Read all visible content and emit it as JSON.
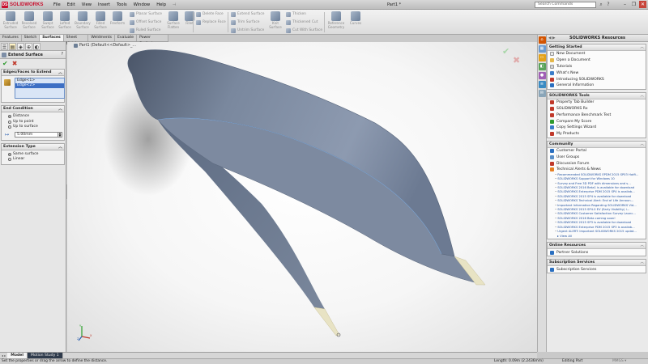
{
  "app": {
    "logo_text": "SOLIDWORKS",
    "doc_title": "Part1 *",
    "menu": [
      "File",
      "Edit",
      "View",
      "Insert",
      "Tools",
      "Window",
      "Help"
    ],
    "menu_pin": "⊣",
    "search_placeholder": "Search Commands",
    "window_controls": [
      "–",
      "❐",
      "✕"
    ]
  },
  "ribbon": {
    "big": [
      {
        "label": "Extruded Surface"
      },
      {
        "label": "Revolved Surface"
      },
      {
        "label": "Swept Surface"
      },
      {
        "label": "Lofted Surface"
      },
      {
        "label": "Boundary Surface"
      },
      {
        "label": "Filled Surface"
      },
      {
        "label": "Freeform"
      },
      {
        "label": "Surface Flatten"
      },
      {
        "label": "Fillet"
      },
      {
        "label": "Knit Surface"
      },
      {
        "label": "Reference Geometry"
      },
      {
        "label": "Curves"
      }
    ],
    "small": [
      "Planar Surface",
      "Offset Surface",
      "Ruled Surface",
      "Delete Face",
      "Replace Face",
      "Extend Surface",
      "Trim Surface",
      "Untrim Surface",
      "Thicken",
      "Thickened Cut",
      "Cut With Surface"
    ]
  },
  "tabs": [
    "Features",
    "Sketch",
    "Surfaces",
    "Sheet Metal",
    "Weldments",
    "Evaluate",
    "Power Surfacing"
  ],
  "active_tab": "Surfaces",
  "property_manager": {
    "title": "Extend Surface",
    "help": "?",
    "ok": "✔",
    "cancel": "✖",
    "edges_group": {
      "title": "Edges/Faces to Extend",
      "items": [
        "Edge<1>",
        "Edge<2>"
      ]
    },
    "end_condition": {
      "title": "End Condition",
      "options": [
        "Distance",
        "Up to point",
        "Up to surface"
      ],
      "selected": "Distance",
      "distance_value": "5.00mm"
    },
    "extension_type": {
      "title": "Extension Type",
      "options": [
        "Same surface",
        "Linear"
      ],
      "selected": "Same surface"
    },
    "collapse_glyph": "︿"
  },
  "viewport": {
    "tree_label": "Part1  (Default<<Default>_...",
    "confirm_ok": "✔",
    "confirm_cancel": "✖",
    "triad": {
      "x": "X",
      "y": "Y",
      "z": "Z"
    },
    "body_color": "#6f7d94",
    "extension_color": "#e8e3c4"
  },
  "task_pane": {
    "title": "SOLIDWORKS Resources",
    "nav": "◀ ▶",
    "getting_started": {
      "title": "Getting Started",
      "items": [
        "New Document",
        "Open a Document",
        "Tutorials",
        "What's New",
        "Introducing SOLIDWORKS",
        "General Information"
      ]
    },
    "tools": {
      "title": "SOLIDWORKS Tools",
      "items": [
        "Property Tab Builder",
        "SOLIDWORKS Rx",
        "Performance Benchmark Test",
        "Compare My Score",
        "Copy Settings Wizard",
        "My Products"
      ]
    },
    "community": {
      "title": "Community",
      "items": [
        "Customer Portal",
        "User Groups",
        "Discussion Forum",
        "Technical Alerts & News"
      ],
      "news": [
        "Recommended SOLIDWORKS EPDM 2015 SP03 Hotfi...",
        "SOLIDWORKS Support for Windows 10",
        "Survey and Free 3D PDF with dimensions and s...",
        "SOLIDWORKS 2016 Beta1 is available for download",
        "SOLIDWORKS Enterprise PDM 2015 SP4 is availab...",
        "SOLIDWORKS 2015 SP4 is available for download",
        "SOLIDWORKS Technical Alert: End of Life Announ...",
        "Important Information Regarding SOLIDWORKS Vid...",
        "SOLIDWORKS 2015 SP4.0 EV (Early Visibility) i...",
        "SOLIDWORKS Customer Satisfaction Survey Launc...",
        "SOLIDWORKS 2016 Beta coming soon!",
        "SOLIDWORKS 2015 SP3 is available for download",
        "SOLIDWORKS Enterprise PDM 2015 SP3 is availab...",
        "Urgent ALERT: Important SOLIDWORKS 2015 updat..."
      ],
      "view_all": "▸ View All"
    },
    "online": {
      "title": "Online Resources",
      "items": [
        "Partner Solutions"
      ]
    },
    "subscription": {
      "title": "Subscription Services",
      "items": [
        "Subscription Services"
      ]
    },
    "collapse_glyph": "︿"
  },
  "bottom_tabs": [
    "Model",
    "Motion Study 1"
  ],
  "bottom_nav": "◂ ▸",
  "status": {
    "message": "Set the properties or drag the arrow to define the distance.",
    "length": "Length: 0.09m (2.2436mm)",
    "mode": "Editing Part",
    "units": "MMGS  ▾"
  }
}
